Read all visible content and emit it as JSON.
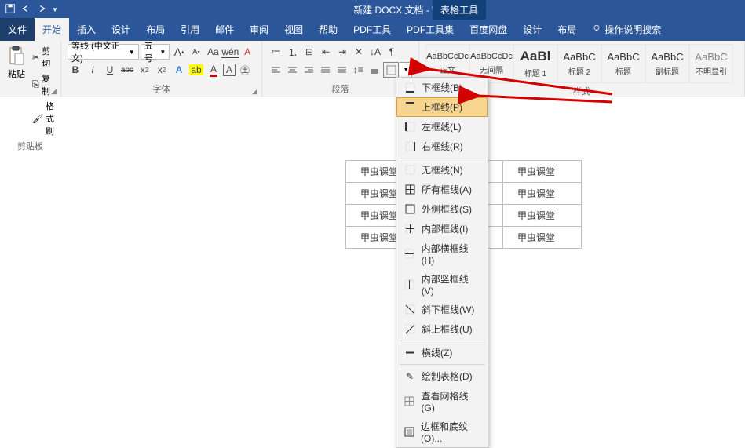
{
  "title": "新建 DOCX 文档 - Word",
  "context_tab": "表格工具",
  "tabs": {
    "file": "文件",
    "home": "开始",
    "insert": "插入",
    "design": "设计",
    "layout": "布局",
    "refs": "引用",
    "mail": "邮件",
    "review": "审阅",
    "view": "视图",
    "help": "帮助",
    "pdf_tool": "PDF工具",
    "pdf_set": "PDF工具集",
    "baidu": "百度网盘",
    "tbl_design": "设计",
    "tbl_layout": "布局",
    "tell_me": "操作说明搜索"
  },
  "clipboard": {
    "paste": "粘贴",
    "cut": "剪切",
    "copy": "复制",
    "painter": "格式刷",
    "group": "剪贴板"
  },
  "font": {
    "name": "等线 (中文正文)",
    "size": "五号",
    "increase": "A",
    "decrease": "A",
    "change_case": "Aa",
    "clear": "A",
    "bold": "B",
    "italic": "I",
    "underline": "U",
    "strike": "abc",
    "sub": "x₂",
    "super": "x²",
    "effects": "A",
    "highlight": "ab",
    "color": "A",
    "group": "字体"
  },
  "paragraph": {
    "group": "段落"
  },
  "styles": {
    "group": "样式",
    "items": [
      {
        "sample": "AaBbCcDc",
        "name": "正文"
      },
      {
        "sample": "AaBbCcDc",
        "name": "无间隔"
      },
      {
        "sample": "AaBl",
        "name": "标题 1"
      },
      {
        "sample": "AaBbC",
        "name": "标题 2"
      },
      {
        "sample": "AaBbC",
        "name": "标题"
      },
      {
        "sample": "AaBbC",
        "name": "副标题"
      },
      {
        "sample": "AaBbC",
        "name": "不明显引"
      }
    ]
  },
  "table_cell": "甲虫课堂",
  "borders_menu": {
    "bottom": "下框线(B)",
    "top": "上框线(P)",
    "left": "左框线(L)",
    "right": "右框线(R)",
    "none": "无框线(N)",
    "all": "所有框线(A)",
    "outside": "外侧框线(S)",
    "inside": "内部框线(I)",
    "inside_h": "内部横框线(H)",
    "inside_v": "内部竖框线(V)",
    "diag_down": "斜下框线(W)",
    "diag_up": "斜上框线(U)",
    "hline": "横线(Z)",
    "draw": "绘制表格(D)",
    "grid": "查看网格线(G)",
    "shading": "边框和底纹(O)..."
  }
}
